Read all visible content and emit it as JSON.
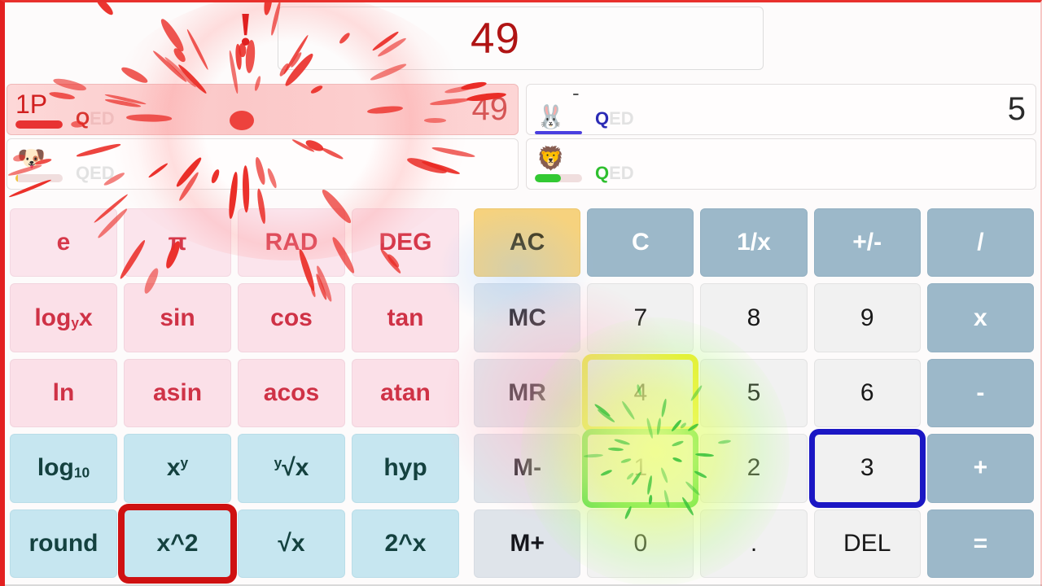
{
  "display": {
    "value": "49"
  },
  "players": [
    {
      "id": "player-1",
      "label": "1P",
      "avatar_icon": "",
      "qed_solved": "Q",
      "qed_rest": "ED",
      "qed_color": "#d8352f",
      "bar_percent": 100,
      "bar_color": "#e83232",
      "score": "49",
      "score_color": "#d65555",
      "active": true,
      "side": "left",
      "row": "top"
    },
    {
      "id": "player-dog",
      "label": "",
      "avatar_icon": "🐶",
      "qed_solved": "",
      "qed_rest": "QED",
      "qed_color": "#e8d7d7",
      "bar_percent": 6,
      "bar_color": "#f0c542",
      "score": "",
      "score_color": "#9a9a9a",
      "active": false,
      "side": "left",
      "row": "bottom"
    },
    {
      "id": "player-rabbit",
      "label": "-",
      "avatar_icon": "🐰",
      "qed_solved": "Q",
      "qed_rest": "ED",
      "qed_color": "#2b2bb5",
      "bar_percent": 100,
      "bar_color": "#4a3fe0",
      "score": "5",
      "score_color": "#2b2b2b",
      "active": false,
      "side": "right",
      "row": "top"
    },
    {
      "id": "player-lion",
      "label": "",
      "avatar_icon": "🦁",
      "qed_solved": "Q",
      "qed_rest": "ED",
      "qed_color": "#2fbf2f",
      "bar_percent": 56,
      "bar_color": "#33c933",
      "score": "",
      "score_color": "#2b2b2b",
      "active": false,
      "side": "right",
      "row": "bottom"
    }
  ],
  "keypad_left": [
    {
      "label": "e",
      "name": "key-e",
      "theme": "t-pink",
      "hl": ""
    },
    {
      "label": "π",
      "name": "key-pi",
      "theme": "t-pink",
      "hl": ""
    },
    {
      "label": "RAD",
      "name": "key-rad",
      "theme": "t-pink",
      "hl": ""
    },
    {
      "label": "DEG",
      "name": "key-deg",
      "theme": "t-pink",
      "hl": ""
    },
    {
      "label": "log_y x",
      "name": "key-log-y-x",
      "theme": "t-pink2",
      "hl": "",
      "html": "log<sub>y</sub>x"
    },
    {
      "label": "sin",
      "name": "key-sin",
      "theme": "t-pink2",
      "hl": ""
    },
    {
      "label": "cos",
      "name": "key-cos",
      "theme": "t-pink2",
      "hl": ""
    },
    {
      "label": "tan",
      "name": "key-tan",
      "theme": "t-pink2",
      "hl": ""
    },
    {
      "label": "ln",
      "name": "key-ln",
      "theme": "t-pink2",
      "hl": ""
    },
    {
      "label": "asin",
      "name": "key-asin",
      "theme": "t-pink2",
      "hl": ""
    },
    {
      "label": "acos",
      "name": "key-acos",
      "theme": "t-pink2",
      "hl": ""
    },
    {
      "label": "atan",
      "name": "key-atan",
      "theme": "t-pink2",
      "hl": ""
    },
    {
      "label": "log10",
      "name": "key-log10",
      "theme": "t-blue",
      "hl": "",
      "html": "log<sub>10</sub>"
    },
    {
      "label": "x^y",
      "name": "key-x-pow-y",
      "theme": "t-blue",
      "hl": "",
      "html": "x<sup>y</sup>"
    },
    {
      "label": "y√x",
      "name": "key-y-root-x",
      "theme": "t-blue",
      "hl": "",
      "html": "<sup>y</sup>√x"
    },
    {
      "label": "hyp",
      "name": "key-hyp",
      "theme": "t-blue",
      "hl": ""
    },
    {
      "label": "round",
      "name": "key-round",
      "theme": "t-blue",
      "hl": ""
    },
    {
      "label": "x^2",
      "name": "key-x-squared",
      "theme": "t-blue",
      "hl": "hl-red"
    },
    {
      "label": "√x",
      "name": "key-sqrt-x",
      "theme": "t-blue",
      "hl": ""
    },
    {
      "label": "2^x",
      "name": "key-2-pow-x",
      "theme": "t-blue",
      "hl": ""
    }
  ],
  "keypad_right": [
    {
      "label": "AC",
      "name": "key-ac",
      "theme": "t-ac",
      "hl": ""
    },
    {
      "label": "C",
      "name": "key-c",
      "theme": "t-op",
      "hl": ""
    },
    {
      "label": "1/x",
      "name": "key-reciprocal",
      "theme": "t-op",
      "hl": ""
    },
    {
      "label": "+/-",
      "name": "key-sign",
      "theme": "t-op",
      "hl": ""
    },
    {
      "label": "/",
      "name": "key-divide",
      "theme": "t-op",
      "hl": ""
    },
    {
      "label": "MC",
      "name": "key-mc",
      "theme": "t-mem",
      "hl": ""
    },
    {
      "label": "7",
      "name": "key-7",
      "theme": "t-num",
      "hl": ""
    },
    {
      "label": "8",
      "name": "key-8",
      "theme": "t-num",
      "hl": ""
    },
    {
      "label": "9",
      "name": "key-9",
      "theme": "t-num",
      "hl": ""
    },
    {
      "label": "x",
      "name": "key-multiply",
      "theme": "t-op",
      "hl": ""
    },
    {
      "label": "MR",
      "name": "key-mr",
      "theme": "t-mem",
      "hl": ""
    },
    {
      "label": "4",
      "name": "key-4",
      "theme": "t-num",
      "hl": "hl-yellow"
    },
    {
      "label": "5",
      "name": "key-5",
      "theme": "t-num",
      "hl": ""
    },
    {
      "label": "6",
      "name": "key-6",
      "theme": "t-num",
      "hl": ""
    },
    {
      "label": "-",
      "name": "key-subtract",
      "theme": "t-op",
      "hl": ""
    },
    {
      "label": "M-",
      "name": "key-m-minus",
      "theme": "t-mem",
      "hl": ""
    },
    {
      "label": "1",
      "name": "key-1",
      "theme": "t-num",
      "hl": "hl-green"
    },
    {
      "label": "2",
      "name": "key-2",
      "theme": "t-num",
      "hl": ""
    },
    {
      "label": "3",
      "name": "key-3",
      "theme": "t-num",
      "hl": "hl-blue"
    },
    {
      "label": "+",
      "name": "key-add",
      "theme": "t-op",
      "hl": ""
    },
    {
      "label": "M+",
      "name": "key-m-plus",
      "theme": "t-mem",
      "hl": ""
    },
    {
      "label": "0",
      "name": "key-0",
      "theme": "t-num",
      "hl": ""
    },
    {
      "label": ".",
      "name": "key-decimal",
      "theme": "t-num",
      "hl": ""
    },
    {
      "label": "DEL",
      "name": "key-delete",
      "theme": "t-num",
      "hl": ""
    },
    {
      "label": "=",
      "name": "key-equals",
      "theme": "t-op",
      "hl": ""
    }
  ],
  "effects": {
    "bang_glyph": "!",
    "burst_color": "#ea2a24",
    "highlight_red": "#cf1111",
    "highlight_blue": "#1b17c4",
    "highlight_yellow": "#f2ea0c",
    "highlight_green": "#1fd41f"
  }
}
